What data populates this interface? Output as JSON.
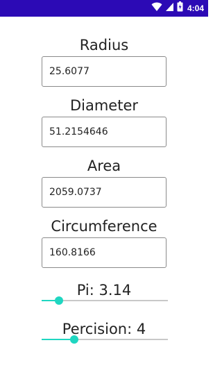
{
  "status_bar": {
    "time": "4:04",
    "icons": [
      "wifi-icon",
      "signal-icon",
      "battery-charging-icon"
    ]
  },
  "fields": {
    "radius": {
      "label": "Radius",
      "value": "25.6077"
    },
    "diameter": {
      "label": "Diameter",
      "value": "51.2154646"
    },
    "area": {
      "label": "Area",
      "value": "2059.0737"
    },
    "circumference": {
      "label": "Circumference",
      "value": "160.8166"
    }
  },
  "sliders": {
    "pi": {
      "label": "Pi: 3.14",
      "fraction": 0.14
    },
    "precision": {
      "label": "Percision: 4",
      "fraction": 0.26
    }
  },
  "colors": {
    "status_bar": "#2c0ab5",
    "accent": "#1fd6c1",
    "track": "#c8c8c8"
  }
}
